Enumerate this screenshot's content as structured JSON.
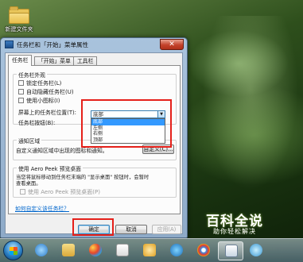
{
  "desktop": {
    "folder_label": "新建文件夹"
  },
  "window": {
    "title": "任务栏和「开始」菜单属性",
    "close_glyph": "✕",
    "tabs": [
      {
        "label": "任务栏"
      },
      {
        "label": "「开始」菜单"
      },
      {
        "label": "工具栏"
      }
    ],
    "appearance_group": {
      "title": "任务栏外观",
      "lock_label": "锁定任务栏(L)",
      "autohide_label": "自动隐藏任务栏(U)",
      "small_icons_label": "使用小图标(I)",
      "position_label": "屏幕上的任务栏位置(T):",
      "buttons_label": "任务栏按钮(B):",
      "position_value": "底部",
      "position_options": [
        "底部",
        "左侧",
        "右侧",
        "顶部"
      ]
    },
    "notify_group": {
      "title": "通知区域",
      "description": "自定义通知区域中出现的图标和通知。",
      "customize_button": "自定义(C)..."
    },
    "aero_group": {
      "title": "使用 Aero Peek 预览桌面",
      "description_line1": "当您将鼠标移动到任务栏末端的 \"显示桌面\" 按钮时，会暂时",
      "description_line2": "查看桌面。",
      "checkbox_label": "使用 Aero Peek 预览桌面(P)"
    },
    "help_link": "如何自定义该任务栏？",
    "buttons": {
      "ok": "确定",
      "cancel": "取消",
      "apply": "应用(A)"
    }
  },
  "watermark": {
    "title": "百科全说",
    "subtitle": "助你轻松解决"
  },
  "colors": {
    "highlight_box": "#e5201a",
    "selection": "#3399ff"
  }
}
